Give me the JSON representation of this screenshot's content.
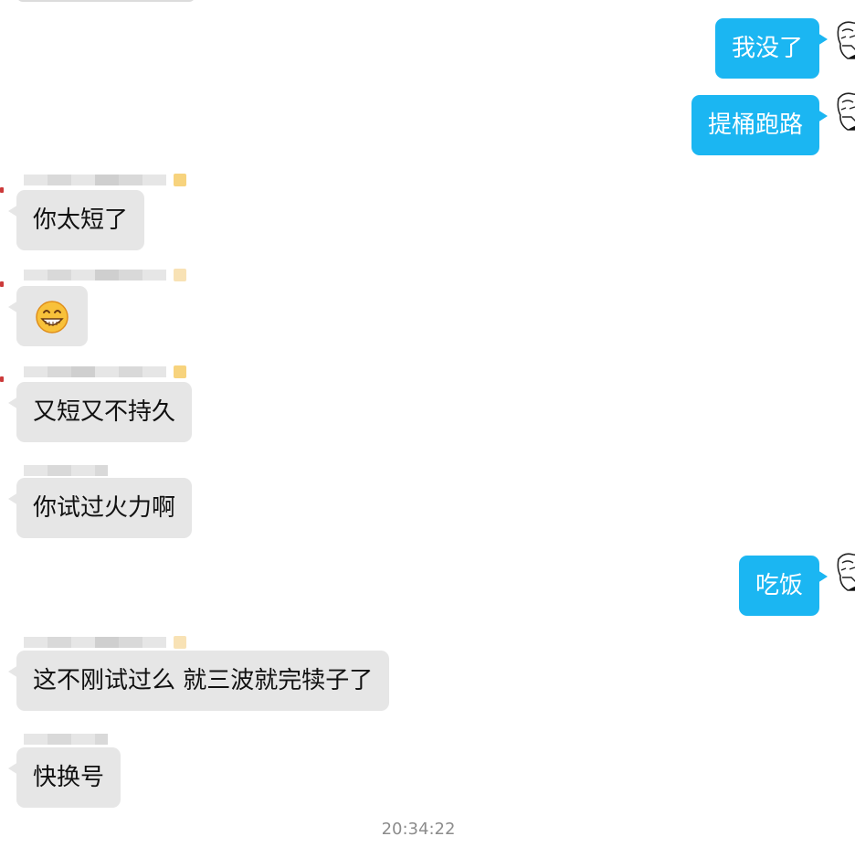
{
  "messages": [
    {
      "direction": "out",
      "text": "我没了"
    },
    {
      "direction": "out",
      "text": "提桶跑路"
    },
    {
      "direction": "in",
      "text": "你太短了"
    },
    {
      "direction": "in",
      "emoji": "grin-emoji"
    },
    {
      "direction": "in",
      "text": "又短又不持久"
    },
    {
      "direction": "in",
      "text": "你试过火力啊"
    },
    {
      "direction": "out",
      "text": "吃饭"
    },
    {
      "direction": "in",
      "text": "这不刚试过么 就三波就完犊子了"
    },
    {
      "direction": "in",
      "text": "快换号"
    }
  ],
  "timestamp": "20:34:22",
  "colors": {
    "outgoing_bubble": "#1bb6f2",
    "incoming_bubble": "#e6e6e6",
    "timestamp_text": "#8c8c8c"
  }
}
